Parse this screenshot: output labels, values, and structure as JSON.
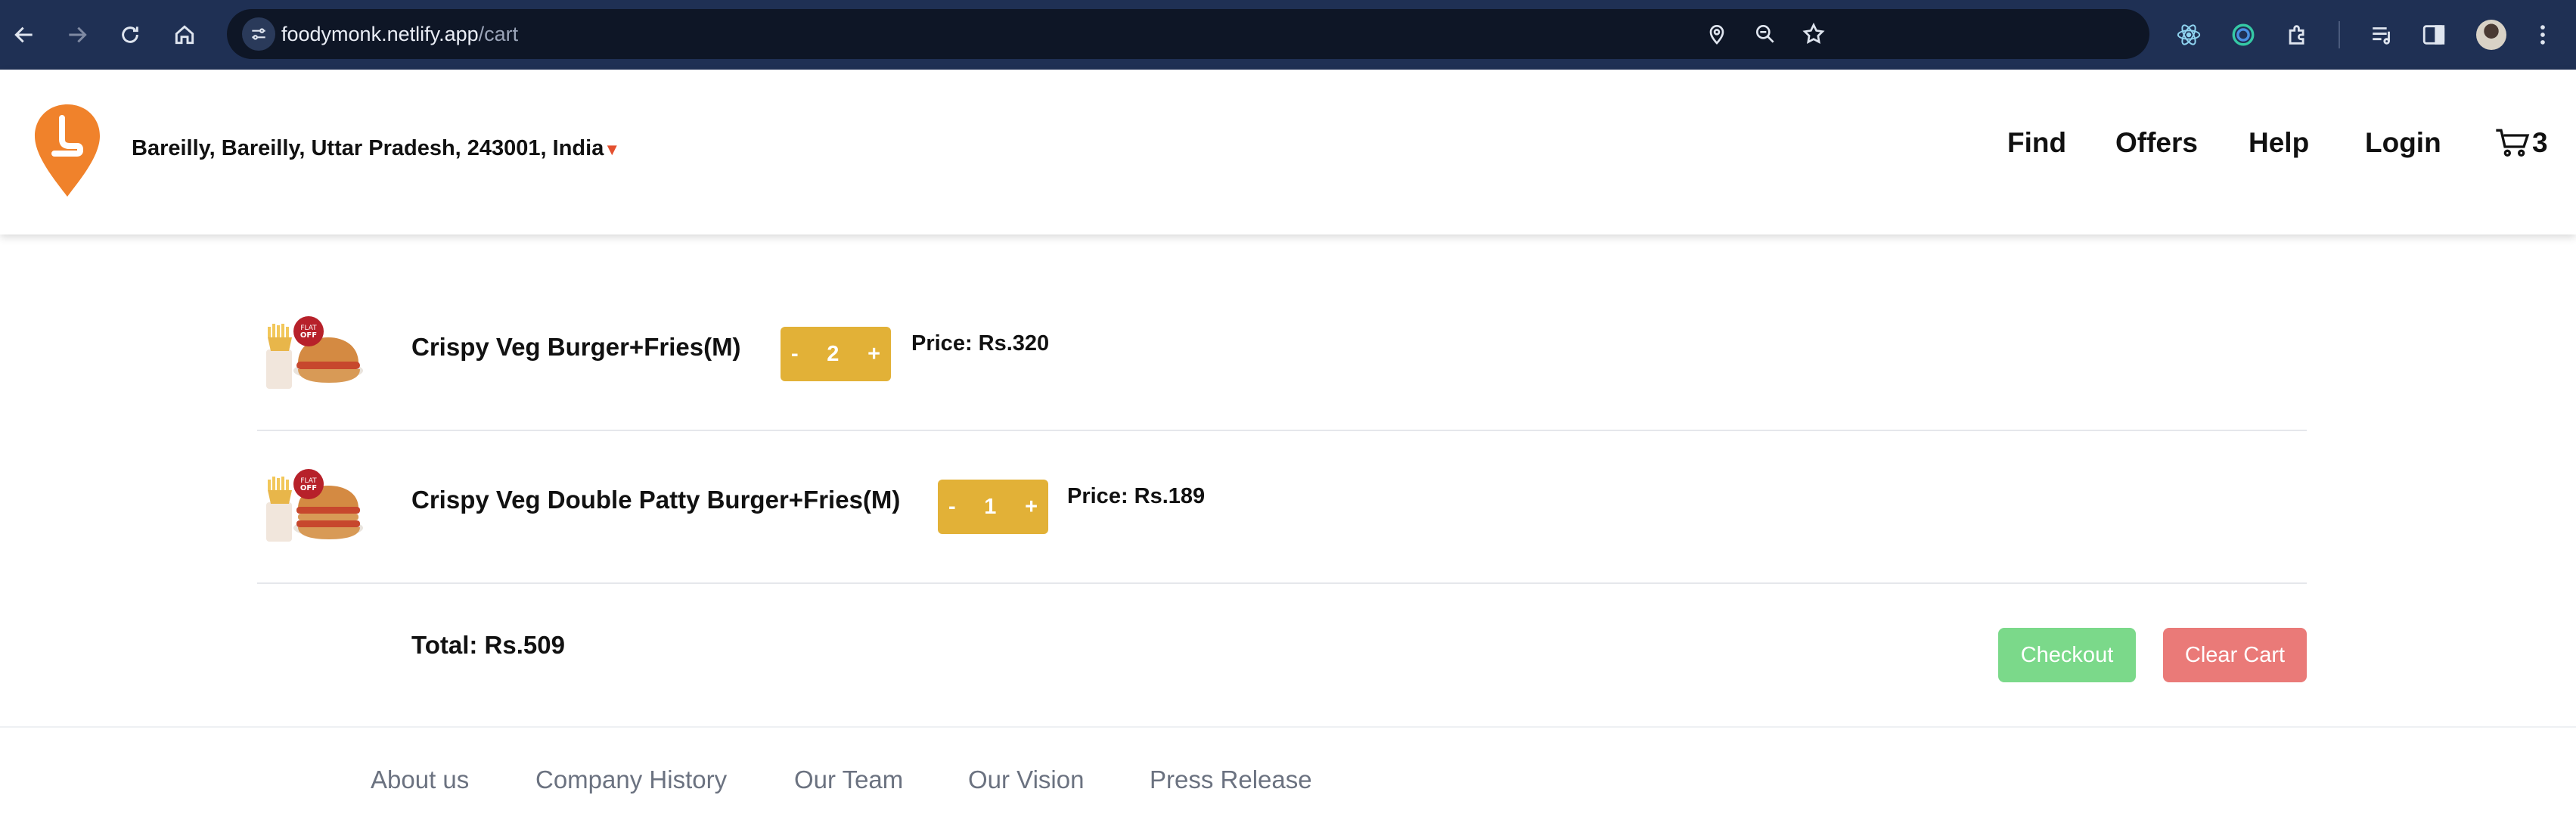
{
  "browser": {
    "url_domain": "foodymonk.netlify.app",
    "url_path": "/cart"
  },
  "header": {
    "location": "Bareilly, Bareilly, Uttar Pradesh, 243001, India",
    "location_caret": "▼",
    "nav": [
      "Find",
      "Offers",
      "Help",
      "Login"
    ],
    "cart_count": "3",
    "brand_color": "#f0822b"
  },
  "cart": {
    "items": [
      {
        "name": "Crispy Veg Burger+Fries(M)",
        "qty": "2",
        "price": "Price: Rs.320"
      },
      {
        "name": "Crispy Veg Double Patty Burger+Fries(M)",
        "qty": "1",
        "price": "Price: Rs.189"
      }
    ],
    "minus_label": "-",
    "plus_label": "+",
    "total": "Total: Rs.509",
    "checkout_label": "Checkout",
    "clear_label": "Clear Cart",
    "checkout_color": "#7bd98a",
    "clear_color": "#ea7a78",
    "qty_color": "#e2b137"
  },
  "footer": {
    "links": [
      "About us",
      "Company History",
      "Our Team",
      "Our Vision",
      "Press Release"
    ]
  }
}
